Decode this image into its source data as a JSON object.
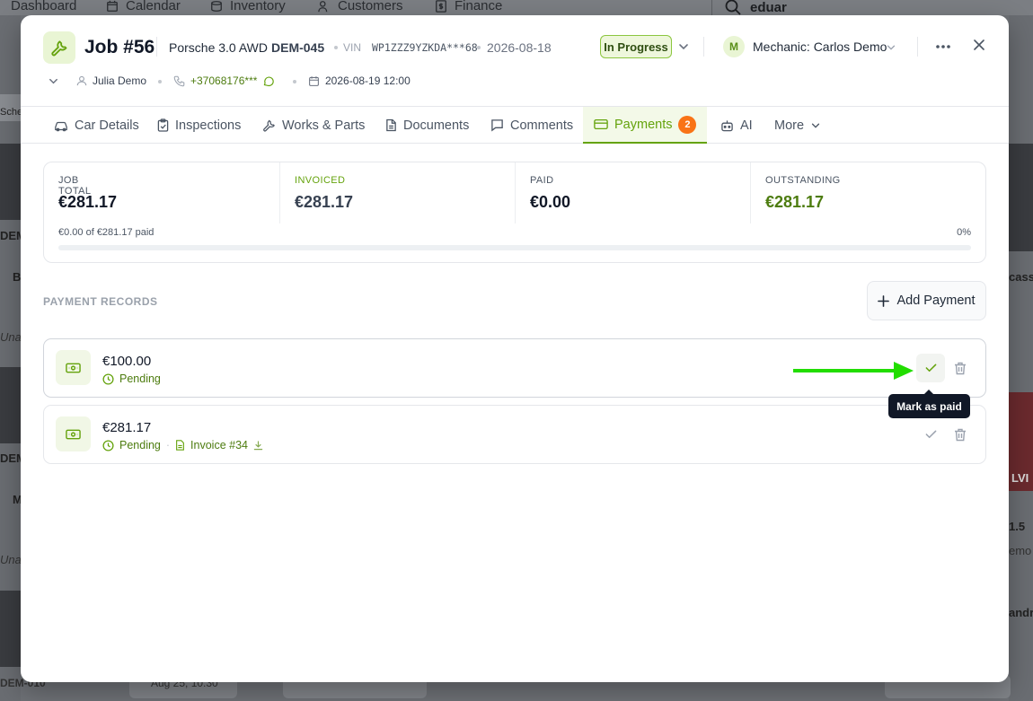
{
  "background": {
    "nav": [
      "Dashboard",
      "Calendar",
      "Inventory",
      "Customers",
      "Finance"
    ],
    "search_value": "eduar",
    "left_fragments": [
      "Sche",
      "DEM",
      "B",
      "Unas",
      "DEM",
      "M",
      "Unas",
      "DEM-010"
    ],
    "right_fragments": [
      "casso",
      "LVI",
      "1.5",
      "emo",
      "andr"
    ],
    "bottom_date": "Aug 25, 10:30"
  },
  "header": {
    "job_title": "Job #56",
    "car_model": "Porsche 3.0 AWD",
    "plate": "DEM-045",
    "vin_label": "VIN",
    "vin": "WP1ZZZ9YZKDA***68",
    "date": "2026-08-18",
    "status": "In Progress",
    "mechanic_initial": "M",
    "mechanic": "Mechanic: Carlos Demo",
    "customer": "Julia Demo",
    "phone": "+37068176***",
    "appointment": "2026-08-19 12:00"
  },
  "tabs": [
    {
      "label": "Car Details",
      "icon": "car-icon"
    },
    {
      "label": "Inspections",
      "icon": "clipboard-icon"
    },
    {
      "label": "Works & Parts",
      "icon": "wrench-icon"
    },
    {
      "label": "Documents",
      "icon": "document-icon"
    },
    {
      "label": "Comments",
      "icon": "comment-icon"
    },
    {
      "label": "Payments",
      "icon": "card-icon",
      "badge": "2",
      "active": true
    },
    {
      "label": "AI",
      "icon": "robot-icon"
    },
    {
      "label": "More",
      "icon": "chevron-down-icon"
    }
  ],
  "summary": {
    "job_total_label": "JOB TOTAL",
    "job_total": "€281.17",
    "invoiced_label": "INVOICED",
    "invoiced": "€281.17",
    "paid_label": "PAID",
    "paid": "€0.00",
    "outstanding_label": "OUTSTANDING",
    "outstanding": "€281.17",
    "progress_text": "€0.00 of €281.17 paid",
    "progress_pct": "0%",
    "progress_fraction": 0
  },
  "records": {
    "title": "PAYMENT RECORDS",
    "add_label": "Add Payment",
    "items": [
      {
        "amount": "€100.00",
        "status": "Pending"
      },
      {
        "amount": "€281.17",
        "status": "Pending",
        "invoice": "Invoice #34"
      }
    ],
    "tooltip": "Mark as paid"
  },
  "colors": {
    "accent": "#65a30d",
    "badge": "#f97316",
    "arrow": "#22dd00"
  }
}
